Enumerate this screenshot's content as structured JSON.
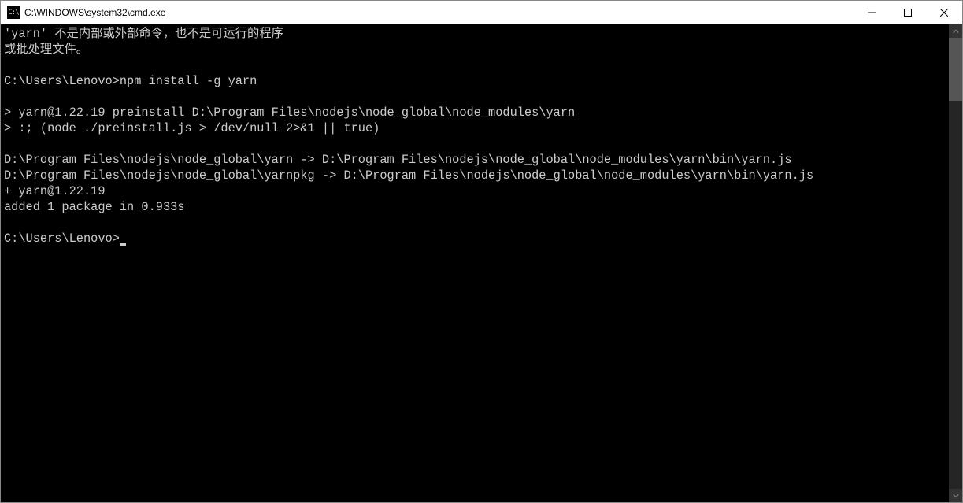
{
  "window": {
    "title": "C:\\WINDOWS\\system32\\cmd.exe",
    "icon_label": "cmd-icon"
  },
  "terminal": {
    "lines": [
      "'yarn' 不是内部或外部命令，也不是可运行的程序",
      "或批处理文件。",
      "",
      "C:\\Users\\Lenovo>npm install -g yarn",
      "",
      "> yarn@1.22.19 preinstall D:\\Program Files\\nodejs\\node_global\\node_modules\\yarn",
      "> :; (node ./preinstall.js > /dev/null 2>&1 || true)",
      "",
      "D:\\Program Files\\nodejs\\node_global\\yarn -> D:\\Program Files\\nodejs\\node_global\\node_modules\\yarn\\bin\\yarn.js",
      "D:\\Program Files\\nodejs\\node_global\\yarnpkg -> D:\\Program Files\\nodejs\\node_global\\node_modules\\yarn\\bin\\yarn.js",
      "+ yarn@1.22.19",
      "added 1 package in 0.933s",
      ""
    ],
    "prompt": "C:\\Users\\Lenovo>"
  }
}
